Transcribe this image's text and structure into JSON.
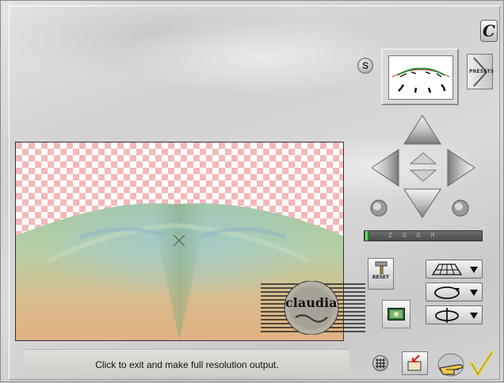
{
  "toolbar": {
    "presets_label": "PRESETS",
    "reset_label": "RESET",
    "zoom_label": "ZOOM",
    "s_label": "S",
    "logo_letter": "C"
  },
  "status": {
    "text": "Click to exit and make full resolution output."
  },
  "watermark": {
    "text": "claudia"
  },
  "controls": {
    "zoom_level": 0.0,
    "tool_buttons": [
      {
        "name": "perspective-grid-tool",
        "icon": "perspective-grid-icon"
      },
      {
        "name": "rotate-tool",
        "icon": "rotate-circle-icon"
      },
      {
        "name": "spin-tool",
        "icon": "spin-axis-icon"
      }
    ]
  },
  "colors": {
    "accent_green": "#2a9a2a",
    "checker_pink": "#f4b8b8",
    "panel_gray": "#d4d4d4",
    "ok_check_yellow": "#e8d84a"
  }
}
